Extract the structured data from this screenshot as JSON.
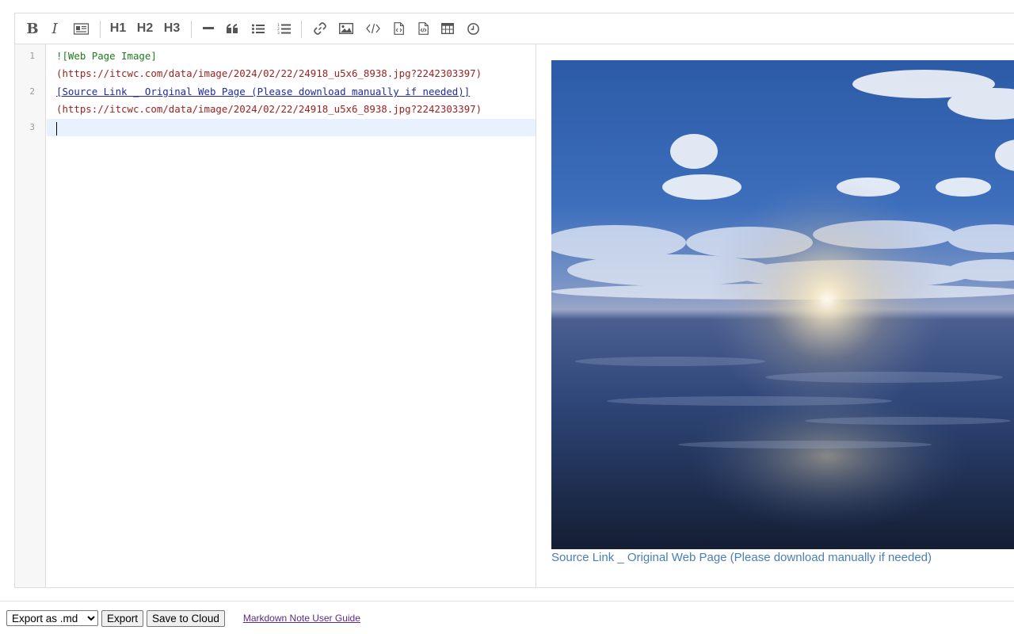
{
  "toolbar": {
    "bold": "B",
    "italic": "I",
    "h1": "H1",
    "h2": "H2",
    "h3": "H3",
    "icons": [
      "bold-icon",
      "italic-icon",
      "preview-card-icon",
      "h1",
      "h2",
      "h3",
      "horizontal-rule-icon",
      "quote-icon",
      "bulleted-list-icon",
      "numbered-list-icon",
      "link-icon",
      "image-icon",
      "code-icon",
      "code-file-icon",
      "code-file-alt-icon",
      "table-icon",
      "clock-icon"
    ]
  },
  "editor": {
    "line_numbers": [
      "1",
      "2",
      "3"
    ],
    "lines": [
      {
        "a": "![Web Page Image]",
        "b": "(https://itcwc.com/data/image/2024/02/22/24918_u5x6_8938.jpg?2242303397)"
      },
      {
        "a": "[Source Link _ Original Web Page (Please download manually if needed)]",
        "b": "(https://itcwc.com/data/image/2024/02/22/24918_u5x6_8938.jpg?2242303397)"
      },
      {
        "a": "",
        "b": ""
      }
    ]
  },
  "preview": {
    "image_alt": "Web Page Image",
    "link_text": "Source Link _ Original Web Page (Please download manually if needed)"
  },
  "footer": {
    "export_options": [
      "Export as .md"
    ],
    "export_selected": "Export as .md",
    "export_button": "Export",
    "save_button": "Save to Cloud",
    "guide_link": "Markdown Note User Guide"
  },
  "colors": {
    "alt_text": "#1e7b1e",
    "url": "#9a2222",
    "link": "#1f2aa0",
    "preview_link": "#4a7fb5",
    "active_line": "#e8f2fe"
  }
}
